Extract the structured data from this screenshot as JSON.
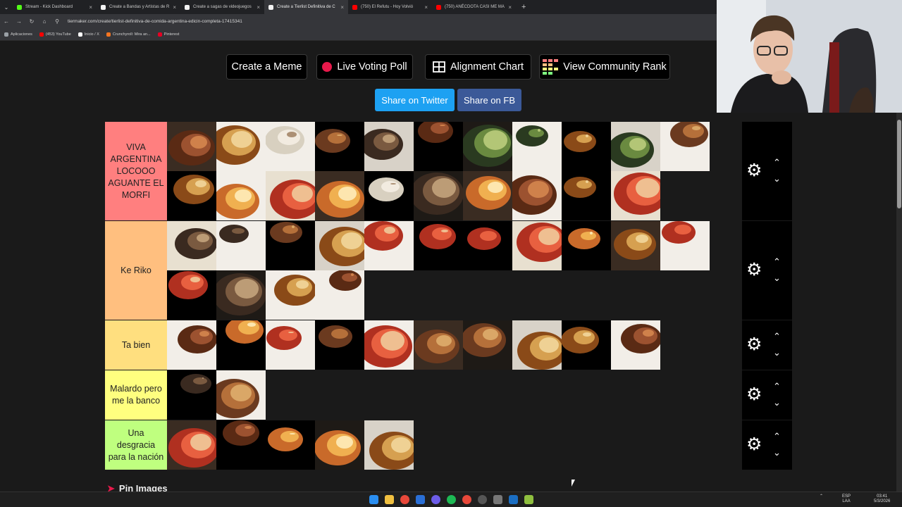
{
  "browser": {
    "tabs": [
      {
        "title": "Stream - Kick Dashboard",
        "color": "#53fc18",
        "active": false
      },
      {
        "title": "Create a Bandas y Artistas de R",
        "color": "#f2f2f2",
        "active": false
      },
      {
        "title": "Create a sagas de videojuegos",
        "color": "#f2f2f2",
        "active": false
      },
      {
        "title": "Create a Tierlist Definitiva de C",
        "color": "#f2f2f2",
        "active": true
      },
      {
        "title": "(750) El Refutu - Hoy Volvió",
        "color": "#ff0000",
        "active": false
      },
      {
        "title": "(750) ANÉCDOTA CASI ME MA",
        "color": "#ff0000",
        "active": false
      }
    ],
    "new_tab": "+",
    "url": "tiermaker.com/create/tierlist-definitiva-de-comida-argentina-edicin-completa-17415341",
    "bookmarks": [
      {
        "label": "Aplicaciones",
        "color": "#9aa0a6"
      },
      {
        "label": "(453) YouTube",
        "color": "#ff0000"
      },
      {
        "label": "Inicio / X",
        "color": "#ffffff"
      },
      {
        "label": "Crunchyroll: Mira an...",
        "color": "#f47521"
      },
      {
        "label": "Pinterest",
        "color": "#e60023"
      }
    ]
  },
  "toolbar": {
    "create_meme": "Create a Meme",
    "live_voting": "Live Voting Poll",
    "alignment_chart": "Alignment Chart",
    "community_rank": "View Community Rank",
    "share_twitter": "Share on Twitter",
    "share_fb": "Share on FB",
    "colors": {
      "twitter": "#1da1f2",
      "fb": "#3b5998",
      "poll_dot": "#e8194b"
    }
  },
  "tiers": [
    {
      "label": "VIVA ARGENTINA LOCOOO AGUANTE EL MORFI",
      "color": "#ff7f7f",
      "items": [
        "asado",
        "asado-vertical",
        "milanesa",
        "puchero",
        "empanadas-fritas",
        "locro-bowl",
        "guiso",
        "pizza-rucula",
        "fugazzeta",
        "vitel-tone",
        "sandwich-de-miga",
        "pan-de-queso",
        "facturas",
        "chipa",
        "medialunas",
        "alfajor-chocolate",
        "alfajor-maicena",
        "dulce-de-leche",
        "brownie",
        "cerveza-jarro",
        "fernet-coca"
      ]
    },
    {
      "label": "Ke Riko",
      "color": "#ffbf7f",
      "items": [
        "choripan",
        "picada",
        "fugazza",
        "matambre",
        "panqueque",
        "tortilla",
        "papas-fritas",
        "mantecol",
        "bizcochitos",
        "pastafrola",
        "bolas-de-fraile",
        "bunuelos",
        "churros",
        "bombon",
        "panqueques-dulce-de-leche"
      ]
    },
    {
      "label": "Ta bien",
      "color": "#ffdf7f",
      "items": [
        "matambre-arrollado",
        "huevos-rellenos",
        "pascualina",
        "fideos",
        "ensalada-rusa",
        "sandwich-triple",
        "sandwich-de-miga-pan",
        "postre-en-vaso",
        "trufas",
        "pastel-de-papa"
      ]
    },
    {
      "label": "Malardo pero me la banco",
      "color": "#ffff7f",
      "items": [
        "guiso-de-lentejas",
        "arroz-con-leche-crema"
      ]
    },
    {
      "label": "Una desgracia para la nación",
      "color": "#bfff7f",
      "items": [
        "locro",
        "arrollado-primavera",
        "arroz-con-leche",
        "flan",
        "rogel"
      ]
    }
  ],
  "icons": {
    "gear": "⚙",
    "up": "⌃",
    "down": "⌄"
  },
  "pin_images": "Pin Images",
  "taskbar": {
    "lang": "ESP",
    "lang2": "LAA",
    "time": "03:41",
    "date": "5/3/2026"
  }
}
